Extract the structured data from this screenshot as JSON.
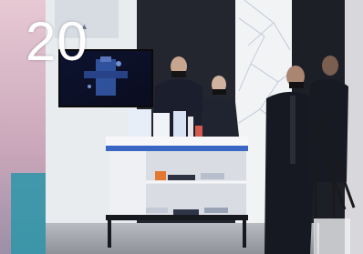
{
  "overlay": {
    "number": "20"
  }
}
